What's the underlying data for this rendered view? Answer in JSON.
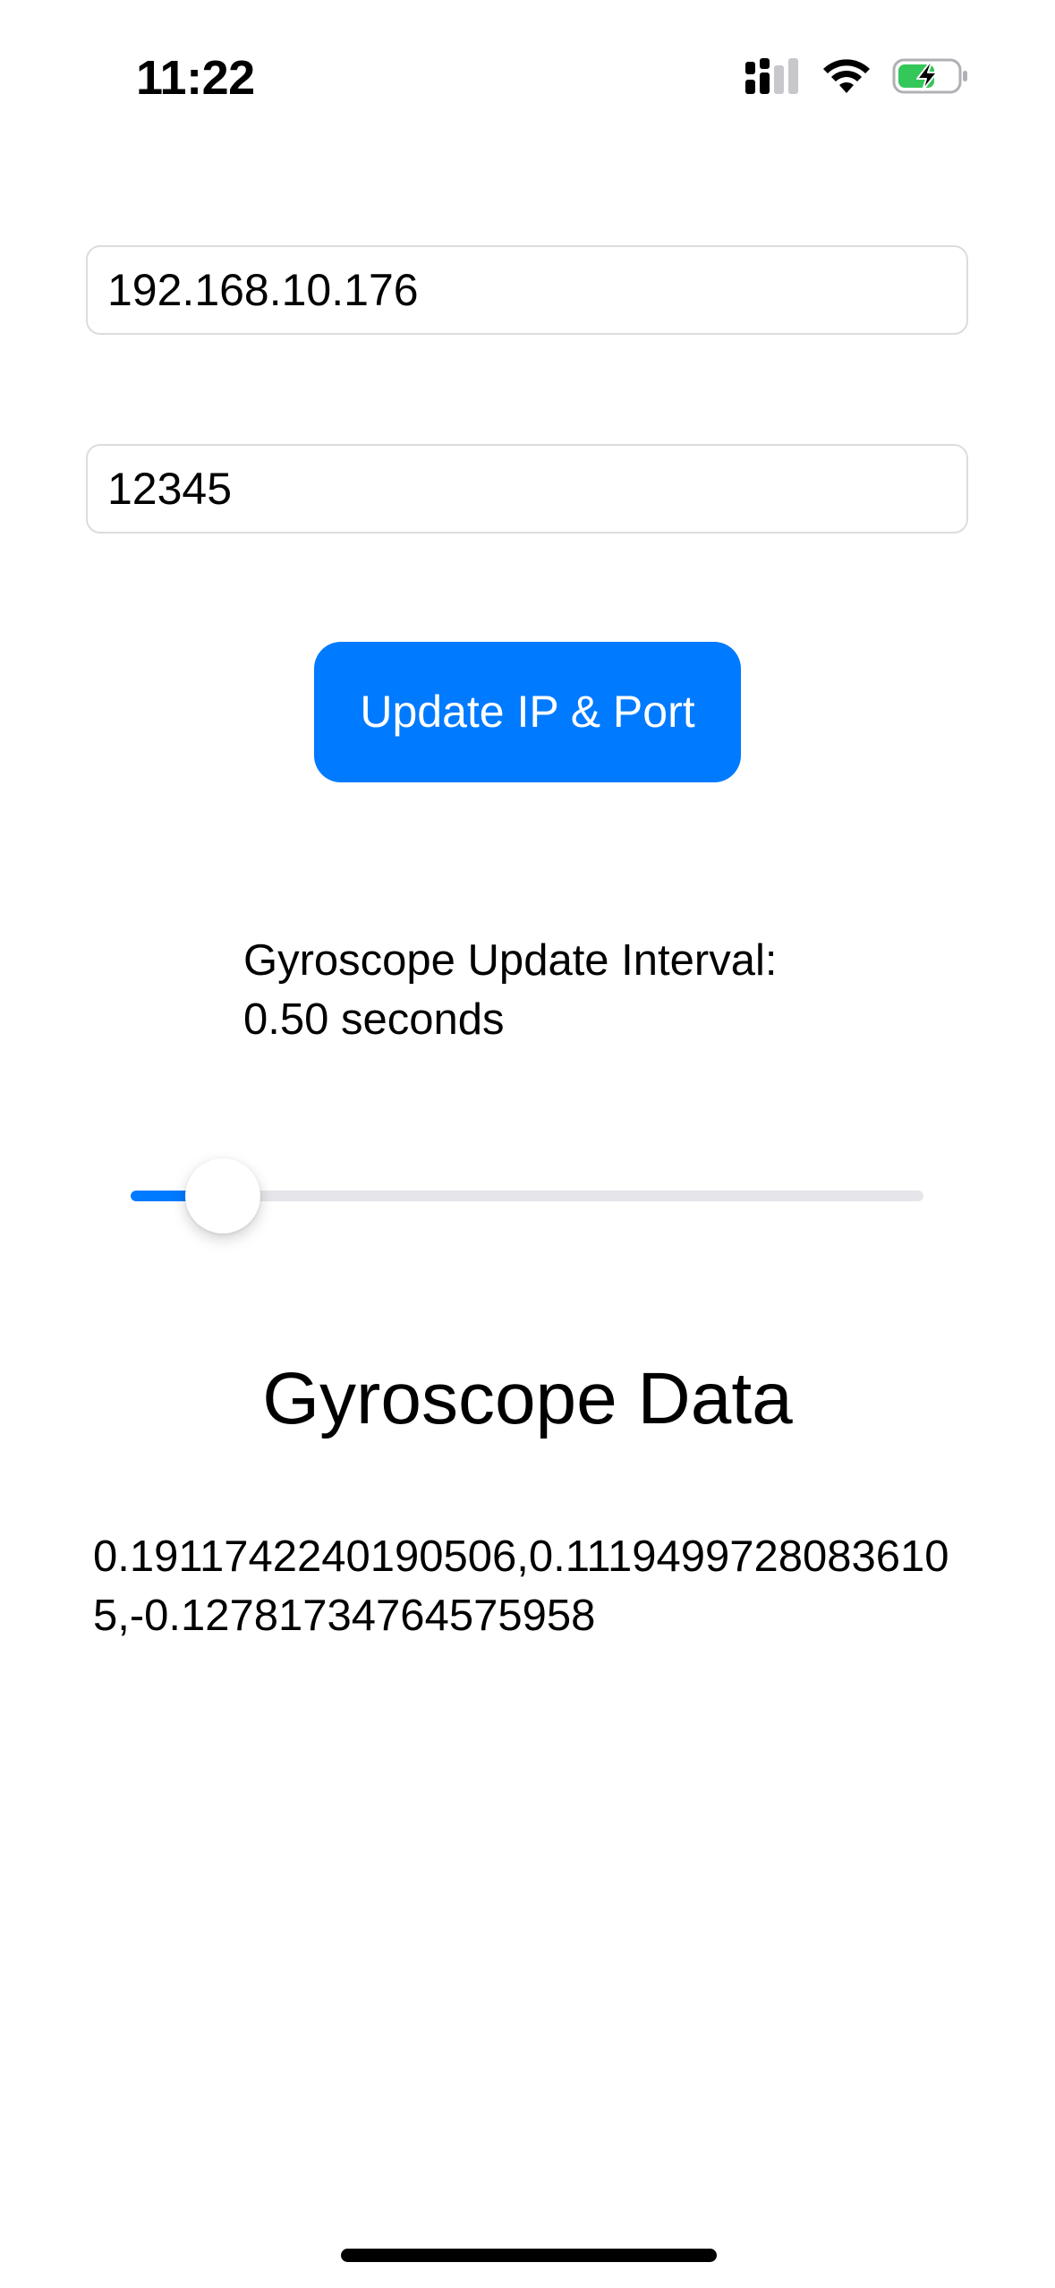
{
  "status_bar": {
    "time": "11:22",
    "icons": [
      "cellular-signal-icon",
      "wifi-icon",
      "battery-charging-icon"
    ]
  },
  "ip_field": {
    "value": "192.168.10.176"
  },
  "port_field": {
    "value": "12345"
  },
  "update_button": {
    "label": "Update IP & Port"
  },
  "interval": {
    "label_line1": "Gyroscope Update Interval:",
    "label_line2": "0.50 seconds",
    "slider_fraction": 0.116
  },
  "gyro": {
    "title": "Gyroscope Data",
    "values": "0.1911742240190506,0.11194997280836105,-0.12781734764575958"
  },
  "colors": {
    "accent": "#007aff",
    "battery_green": "#34c759",
    "field_border": "#dcdcdc"
  }
}
